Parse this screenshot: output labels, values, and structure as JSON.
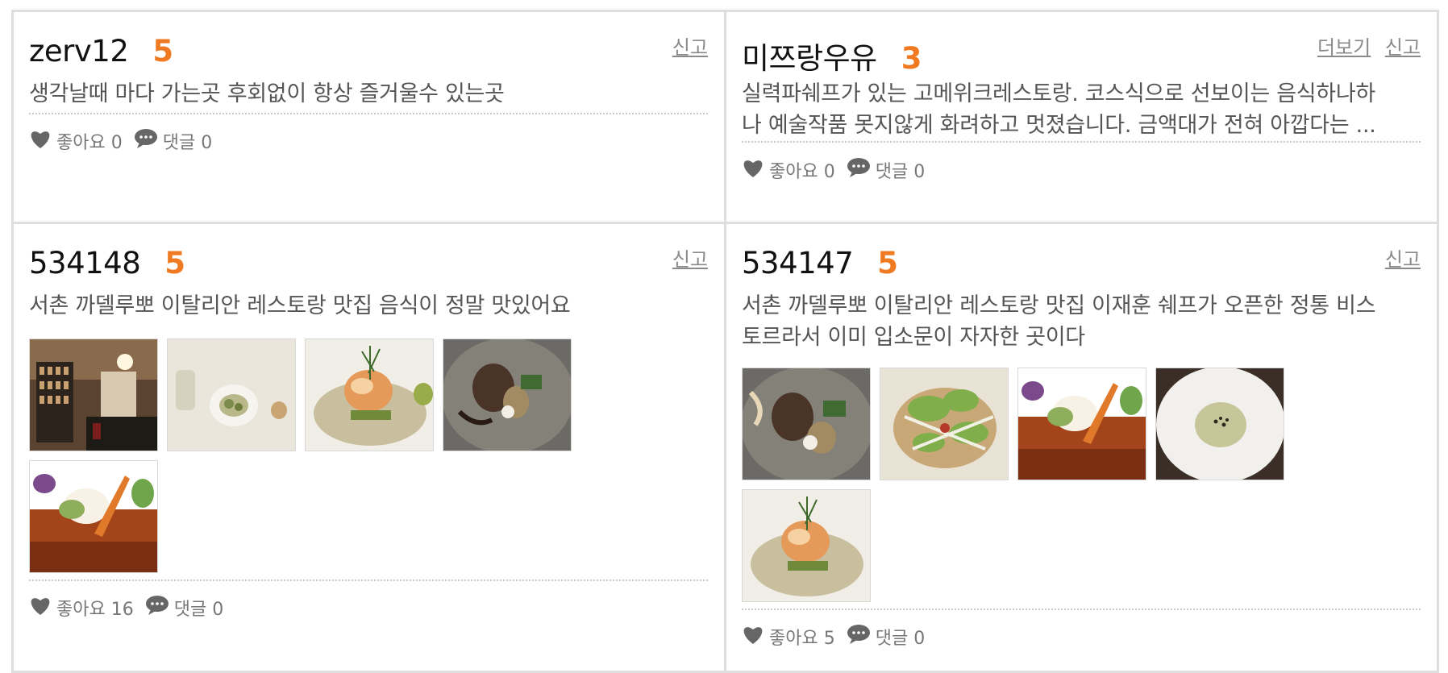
{
  "reviews": [
    {
      "user": "zerv12",
      "score": "5",
      "text_lines": [
        "생각날때 마다 가는곳 후회없이 항상 즐거울수 있는곳"
      ],
      "more_label": "",
      "report_label": "신고",
      "like_label": "좋아요 0",
      "comment_label": "댓글 0",
      "photos": []
    },
    {
      "user": "미쯔랑우유",
      "score": "3",
      "text_lines": [
        "실력파쉐프가 있는 고메위크레스토랑. 코스식으로 선보이는 음식하나하",
        "나 예술작품 못지않게 화려하고 멋졌습니다. 금액대가 전혀 아깝다는 ..."
      ],
      "more_label": "더보기",
      "report_label": "신고",
      "like_label": "좋아요 0",
      "comment_label": "댓글 0",
      "photos": []
    },
    {
      "user": "534148",
      "score": "5",
      "text_lines": [
        "서촌 까델루뽀 이탈리안 레스토랑 맛집 음식이 정말 맛있어요"
      ],
      "more_label": "",
      "report_label": "신고",
      "like_label": "좋아요 16",
      "comment_label": "댓글 0",
      "photos": [
        "wine-cellar-interior-photo",
        "amuse-bouche-plate-photo",
        "shrimp-dish-photo",
        "steak-dish-photo",
        "carrot-dessert-photo"
      ]
    },
    {
      "user": "534147",
      "score": "5",
      "text_lines": [
        "서촌 까델루뽀 이탈리안 레스토랑 맛집 이재훈 쉐프가 오픈한 정통 비스",
        "토르라서 이미 입소문이 자자한 곳이다"
      ],
      "more_label": "",
      "report_label": "신고",
      "like_label": "좋아요 5",
      "comment_label": "댓글 0",
      "photos": [
        "steak-dish-photo",
        "pasta-salad-photo",
        "carrot-dessert-photo",
        "soup-bowl-photo",
        "shrimp-dish-photo"
      ]
    }
  ],
  "colors": {
    "accent": "#f07a22",
    "text": "#555555",
    "muted": "#8a8a8a",
    "border": "#dedede"
  }
}
